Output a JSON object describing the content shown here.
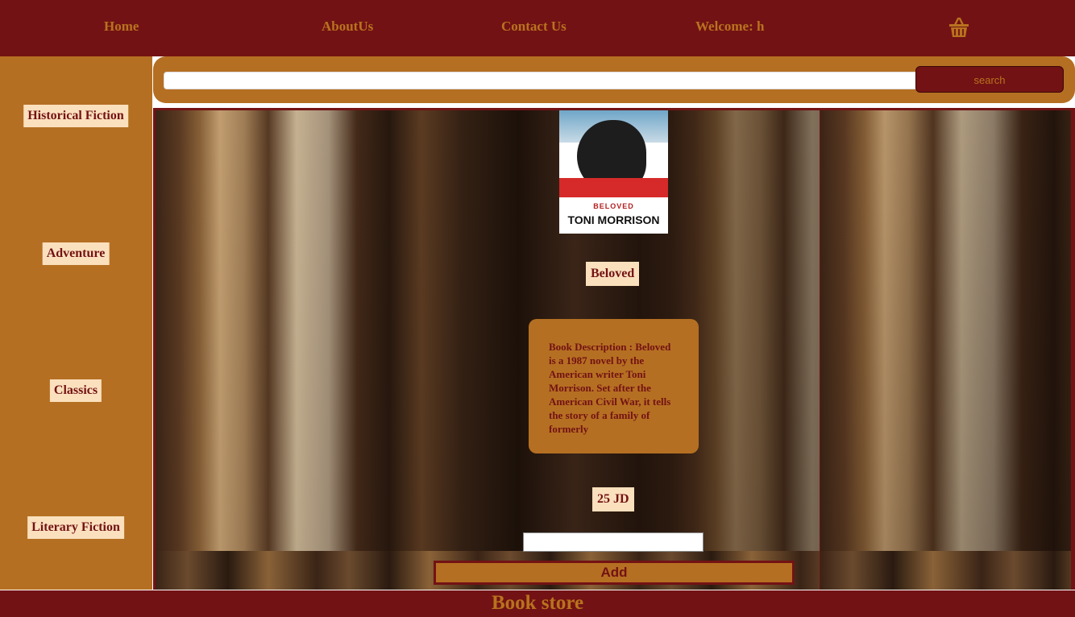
{
  "header": {
    "nav": [
      {
        "label": "Home"
      },
      {
        "label": "AboutUs"
      },
      {
        "label": "Contact Us"
      },
      {
        "label": "Welcome: h"
      }
    ],
    "cart_icon": "basket-icon"
  },
  "sidebar": {
    "categories": [
      {
        "label": "Historical Fiction"
      },
      {
        "label": "Adventure"
      },
      {
        "label": "Classics"
      },
      {
        "label": "Literary Fiction"
      }
    ]
  },
  "search": {
    "value": "",
    "button_label": "search"
  },
  "book": {
    "cover_title": "BELOVED",
    "cover_author": "TONI MORRISON",
    "title": "Beloved",
    "description": "Book Description : Beloved is a 1987 novel by the American writer Toni Morrison. Set after the American Civil War, it tells the story of a family of formerly",
    "price": "25 JD",
    "quantity_value": "",
    "add_label": "Add"
  },
  "footer": {
    "title": "Book store"
  },
  "colors": {
    "primary": "#731214",
    "accent": "#b56f22",
    "label_bg": "#fbe0bd"
  }
}
